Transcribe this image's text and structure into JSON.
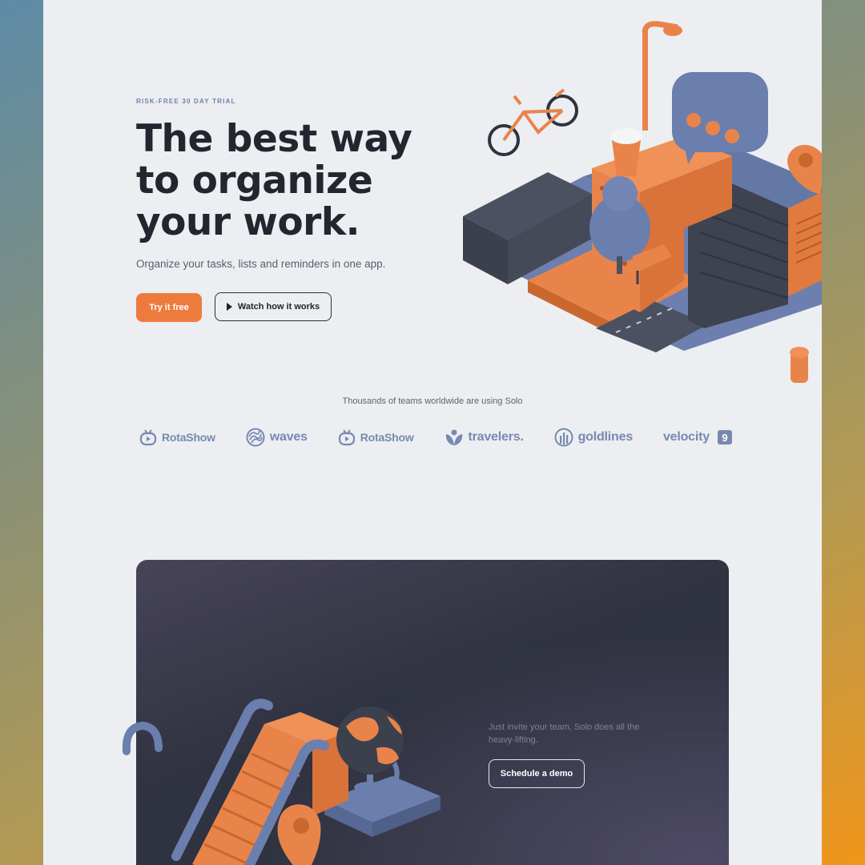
{
  "hero": {
    "eyebrow": "RISK-FREE 30 DAY TRIAL",
    "headline": "The best way to organize your work.",
    "subheadline": "Organize your tasks, lists and reminders in one app.",
    "primary_cta": "Try it free",
    "secondary_cta": "Watch how it works"
  },
  "trust": {
    "caption": "Thousands of teams worldwide are using Solo",
    "logos": [
      {
        "name": "RotaShow",
        "icon": "tv-icon"
      },
      {
        "name": "waves",
        "icon": "waves-icon"
      },
      {
        "name": "RotaShow",
        "icon": "tv-icon"
      },
      {
        "name": "travelers.",
        "icon": "leaf-icon"
      },
      {
        "name": "goldlines",
        "icon": "bars-icon"
      },
      {
        "name": "velocity",
        "badge": "9"
      }
    ]
  },
  "cta_card": {
    "text": "Just invite your team, Solo does all the heavy-lifting.",
    "button": "Schedule a demo"
  },
  "colors": {
    "accent": "#ee7b3e",
    "slate_blue": "#6b7fae",
    "dark": "#23262e",
    "page_bg": "#eceef2",
    "card_bg": "#30333f"
  }
}
